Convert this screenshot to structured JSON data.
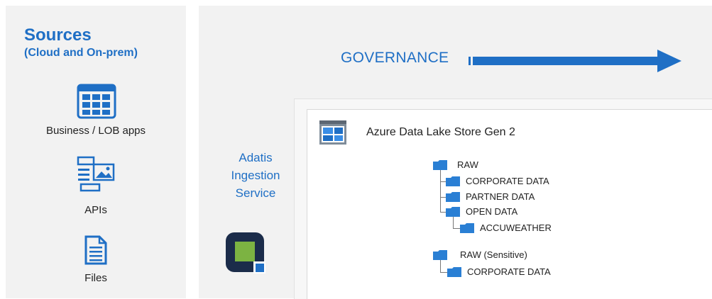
{
  "sources": {
    "title": "Sources",
    "subtitle": "(Cloud and On-prem)",
    "items": [
      {
        "label": "Business / LOB apps",
        "icon": "app-grid-icon"
      },
      {
        "label": "APIs",
        "icon": "api-icon"
      },
      {
        "label": "Files",
        "icon": "document-icon"
      }
    ]
  },
  "governance": {
    "label": "GOVERNANCE"
  },
  "ingestion": {
    "line1": "Adatis",
    "line2": "Ingestion",
    "line3": "Service"
  },
  "lake": {
    "title": "Azure Data Lake Store Gen 2",
    "tree": [
      {
        "label": "RAW"
      },
      {
        "label": "CORPORATE DATA"
      },
      {
        "label": "PARTNER DATA"
      },
      {
        "label": "OPEN DATA"
      },
      {
        "label": "ACCUWEATHER"
      },
      {
        "label": "RAW (Sensitive)"
      },
      {
        "label": "CORPORATE DATA"
      }
    ]
  },
  "colors": {
    "accent": "#1f6fc5",
    "folder": "#2a7fd4",
    "logo_dark": "#1b2c4a",
    "logo_green": "#7cb342"
  }
}
